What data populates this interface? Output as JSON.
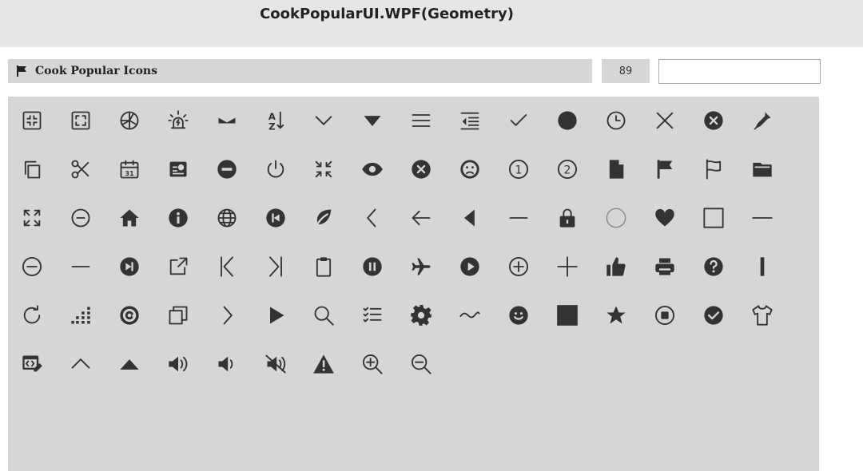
{
  "window": {
    "title": "CookPopularUI.WPF(Geometry)"
  },
  "section": {
    "title": "Cook Popular Icons",
    "icon": "flag-icon"
  },
  "count": "89",
  "search": {
    "value": "",
    "placeholder": ""
  },
  "icons": [
    "collapse-corners",
    "expand-corners",
    "aperture",
    "alarm-light",
    "minimize-bar",
    "sort-az",
    "chevron-down",
    "caret-down",
    "hamburger-menu",
    "indent-list",
    "checkmark",
    "filled-circle",
    "clock",
    "close-x",
    "close-circle",
    "eyedropper",
    "copy",
    "scissors",
    "calendar",
    "id-card",
    "minus-circle-filled",
    "power",
    "compress-arrows",
    "eye",
    "x-circle-filled",
    "sad-face",
    "number-one-circle",
    "number-two-circle",
    "document",
    "flag-filled",
    "flag-outline",
    "folder",
    "expand-arrows",
    "minus-circle-outline",
    "home",
    "info-filled",
    "globe",
    "back-circle-filled",
    "leaf",
    "chevron-left",
    "arrow-left",
    "caret-left",
    "minus",
    "lock",
    "circle-outline",
    "heart",
    "square-outline",
    "dash",
    "minus-circle",
    "minus-bold",
    "next-circle-filled",
    "external-link",
    "step-first",
    "step-last",
    "clipboard",
    "pause-circle",
    "airplane",
    "play-circle-filled",
    "plus-circle",
    "plus",
    "thumbs-up",
    "printer",
    "help-circle",
    "vertical-bar",
    "refresh",
    "signal-dots",
    "at-circle",
    "duplicate",
    "chevron-right",
    "play",
    "search",
    "checklist",
    "gear",
    "wave",
    "smile",
    "square-filled",
    "star",
    "stop-circle",
    "check-circle-filled",
    "t-shirt",
    "code-edit",
    "chevron-up",
    "caret-up",
    "volume-up",
    "volume-low",
    "volume-mute",
    "warning",
    "zoom-in",
    "zoom-out"
  ]
}
